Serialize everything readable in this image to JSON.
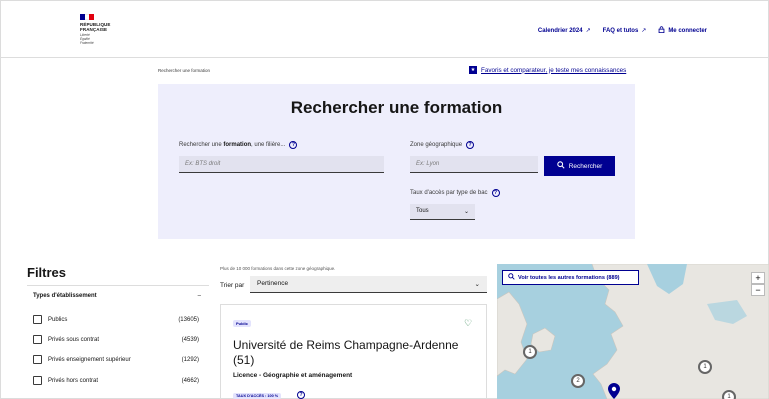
{
  "header": {
    "logo_lines": [
      "RÉPUBLIQUE",
      "FRANÇAISE"
    ],
    "logo_motto": [
      "Liberté",
      "Égalité",
      "Fraternité"
    ],
    "links": [
      {
        "label": "Calendrier 2024"
      },
      {
        "label": "FAQ et tutos"
      },
      {
        "label": "Me connecter"
      }
    ]
  },
  "breadcrumb": "Rechercher une formation",
  "favoris": "Favoris et comparateur, je teste mes connaissances",
  "search": {
    "title": "Rechercher une formation",
    "formation_label_pre": "Rechercher une ",
    "formation_label_bold": "formation",
    "formation_label_post": ", une filière...",
    "formation_placeholder": "Ex: BTS droit",
    "zone_label": "Zone géographique",
    "zone_placeholder": "Ex: Lyon",
    "button_label": "Rechercher",
    "bac_label": "Taux d'accès par type de bac",
    "bac_value": "Tous"
  },
  "filters": {
    "title": "Filtres",
    "group_label": "Types d'établissement",
    "items": [
      {
        "label": "Publics",
        "count": "(13605)"
      },
      {
        "label": "Privés sous contrat",
        "count": "(4539)"
      },
      {
        "label": "Privés enseignement supérieur",
        "count": "(1292)"
      },
      {
        "label": "Privés hors contrat",
        "count": "(4662)"
      }
    ]
  },
  "results": {
    "info": "Plus de 10 000 formations dans cette zone géographique.",
    "sort_label": "Trier par",
    "sort_value": "Pertinence",
    "card": {
      "tag": "Public",
      "title": "Université de Reims Champagne-Ardenne (51)",
      "subtitle": "Licence - Géographie et aménagement",
      "badge": "TAUX D'ACCÈS : 100 %"
    }
  },
  "map": {
    "button_label": "Voir toutes les autres formations (889)",
    "zoom_in": "+",
    "zoom_out": "−",
    "clusters": [
      "1",
      "2",
      "1",
      "1"
    ]
  },
  "colors": {
    "primary": "#000091",
    "panel_bg": "#eeeefc",
    "map_sea": "#a7d0df",
    "map_land": "#e8e6e1"
  }
}
